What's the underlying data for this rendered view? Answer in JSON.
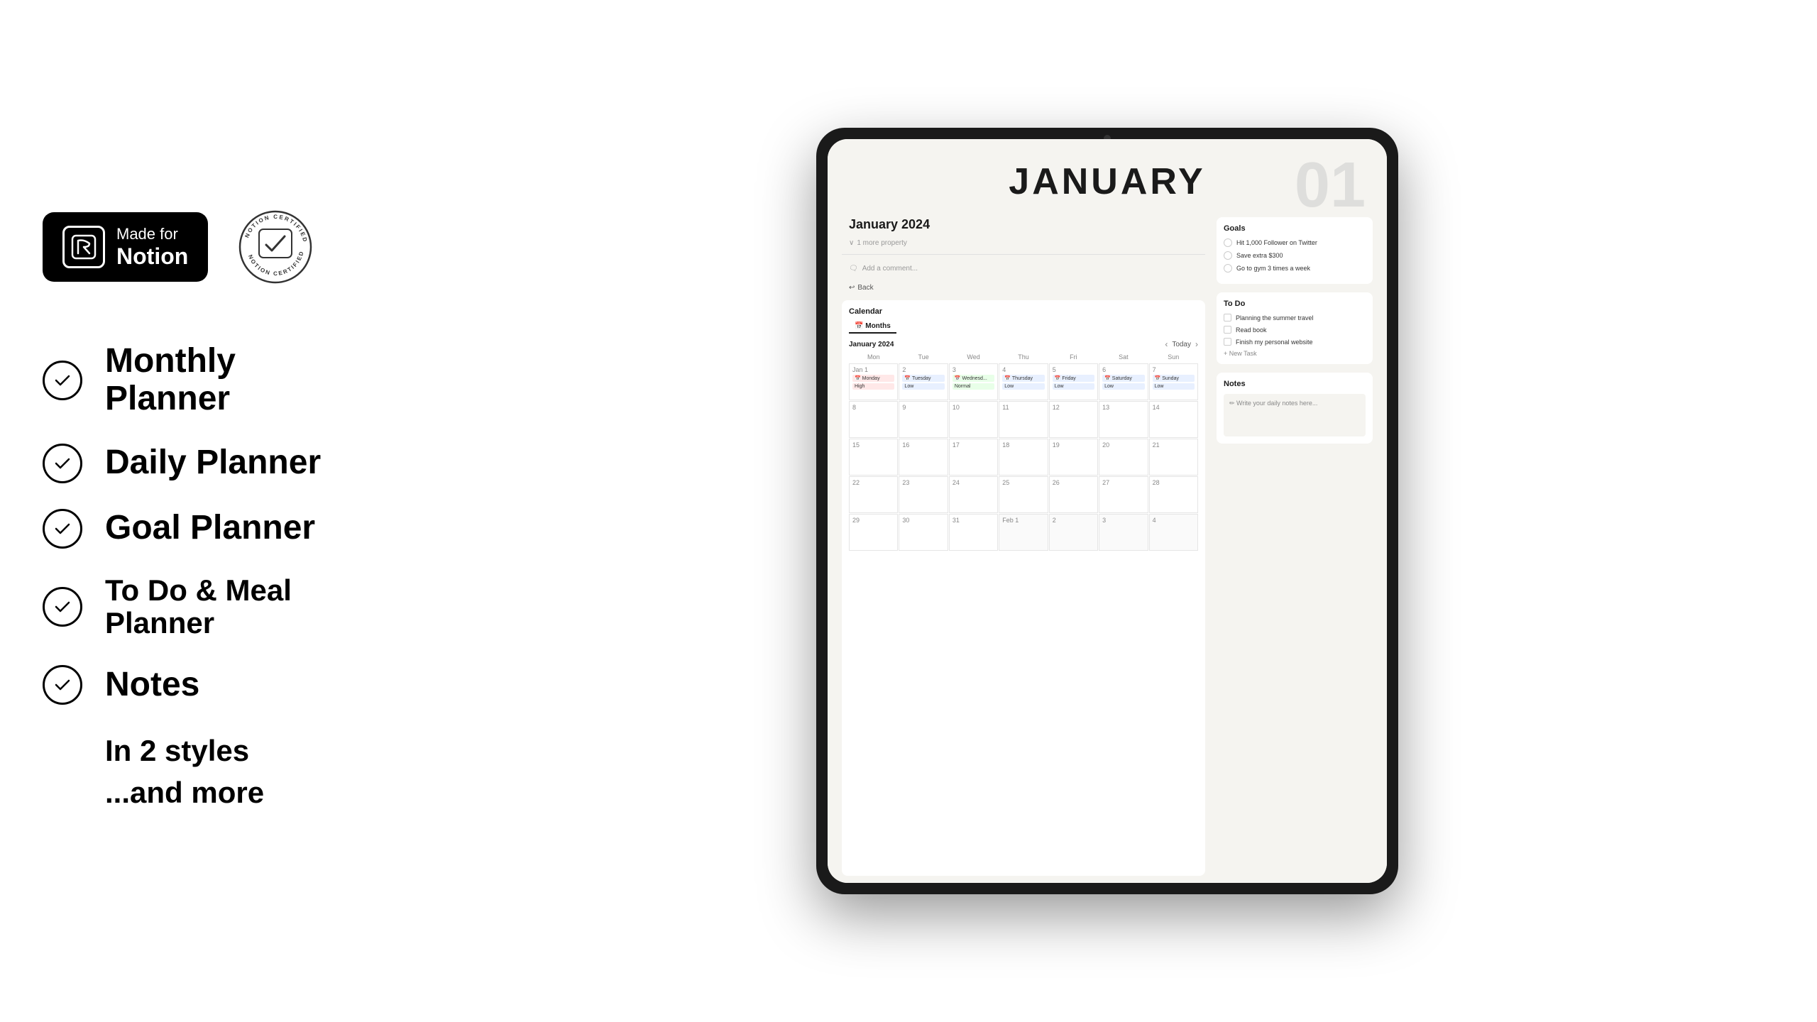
{
  "badges": {
    "notion_badge": {
      "made_for": "Made for",
      "notion": "Notion"
    },
    "certified": "NOTION CERTIFIED"
  },
  "features": [
    {
      "id": "monthly-planner",
      "label": "Monthly Planner"
    },
    {
      "id": "daily-planner",
      "label": "Daily Planner"
    },
    {
      "id": "goal-planner",
      "label": "Goal Planner"
    },
    {
      "id": "todo-meal-planner",
      "label": "To Do & Meal Planner"
    },
    {
      "id": "notes",
      "label": "Notes"
    }
  ],
  "extras": [
    {
      "id": "styles",
      "label": "In 2 styles"
    },
    {
      "id": "more",
      "label": "...and more"
    }
  ],
  "notion_page": {
    "month_title": "JANUARY",
    "watermark": "01",
    "page_subtitle": "January 2024",
    "meta": "1 more property",
    "comment_placeholder": "Add a comment...",
    "back_label": "Back",
    "calendar_section_title": "Calendar",
    "calendar_month": "January 2024",
    "today_label": "Today",
    "tab_months": "Months",
    "day_names": [
      "Mon",
      "Tue",
      "Wed",
      "Thu",
      "Fri",
      "Sat",
      "Sun"
    ],
    "weeks": [
      [
        {
          "date": "Jan 1",
          "event": "Monday",
          "badge": "High",
          "type": "high"
        },
        {
          "date": "2",
          "event": "Tuesday",
          "badge": "Low",
          "type": "low"
        },
        {
          "date": "3",
          "event": "Wednesd...",
          "badge": "Normal",
          "type": "normal"
        },
        {
          "date": "4",
          "event": "Thursday",
          "badge": "Low",
          "type": "low"
        },
        {
          "date": "5",
          "event": "Friday",
          "badge": "Low",
          "type": "low"
        },
        {
          "date": "6",
          "event": "Saturday",
          "badge": "Low",
          "type": "low"
        },
        {
          "date": "7",
          "event": "Sunday",
          "badge": "Low",
          "type": "low"
        }
      ],
      [
        {
          "date": "8",
          "event": "",
          "badge": "",
          "type": ""
        },
        {
          "date": "9",
          "event": "",
          "badge": "",
          "type": ""
        },
        {
          "date": "10",
          "event": "",
          "badge": "",
          "type": ""
        },
        {
          "date": "11",
          "event": "",
          "badge": "",
          "type": ""
        },
        {
          "date": "12",
          "event": "",
          "badge": "",
          "type": ""
        },
        {
          "date": "13",
          "event": "",
          "badge": "",
          "type": ""
        },
        {
          "date": "14",
          "event": "",
          "badge": "",
          "type": ""
        }
      ],
      [
        {
          "date": "15",
          "event": "",
          "badge": "",
          "type": ""
        },
        {
          "date": "16",
          "event": "",
          "badge": "",
          "type": ""
        },
        {
          "date": "17",
          "event": "",
          "badge": "",
          "type": ""
        },
        {
          "date": "18",
          "event": "",
          "badge": "",
          "type": ""
        },
        {
          "date": "19",
          "event": "",
          "badge": "",
          "type": ""
        },
        {
          "date": "20",
          "event": "",
          "badge": "",
          "type": ""
        },
        {
          "date": "21",
          "event": "",
          "badge": "",
          "type": ""
        }
      ],
      [
        {
          "date": "22",
          "event": "",
          "badge": "",
          "type": ""
        },
        {
          "date": "23",
          "event": "",
          "badge": "",
          "type": ""
        },
        {
          "date": "24",
          "event": "",
          "badge": "",
          "type": ""
        },
        {
          "date": "25",
          "event": "",
          "badge": "",
          "type": ""
        },
        {
          "date": "26",
          "event": "",
          "badge": "",
          "type": ""
        },
        {
          "date": "27",
          "event": "",
          "badge": "",
          "type": ""
        },
        {
          "date": "28",
          "event": "",
          "badge": "",
          "type": ""
        }
      ],
      [
        {
          "date": "29",
          "event": "",
          "badge": "",
          "type": ""
        },
        {
          "date": "30",
          "event": "",
          "badge": "",
          "type": ""
        },
        {
          "date": "31",
          "event": "",
          "badge": "",
          "type": ""
        },
        {
          "date": "Feb 1",
          "event": "",
          "badge": "",
          "type": "other"
        },
        {
          "date": "2",
          "event": "",
          "badge": "",
          "type": "other"
        },
        {
          "date": "3",
          "event": "",
          "badge": "",
          "type": "other"
        },
        {
          "date": "4",
          "event": "",
          "badge": "",
          "type": "other"
        }
      ]
    ],
    "goals_title": "Goals",
    "goals": [
      "Hit 1,000 Follower on Twitter",
      "Save extra $300",
      "Go to gym 3 times a week"
    ],
    "todo_title": "To Do",
    "todos": [
      "Planning the summer travel",
      "Read book",
      "Finish my personal website"
    ],
    "new_task_label": "+ New Task",
    "notes_title": "Notes",
    "notes_placeholder": "✏ Write your daily notes here..."
  }
}
